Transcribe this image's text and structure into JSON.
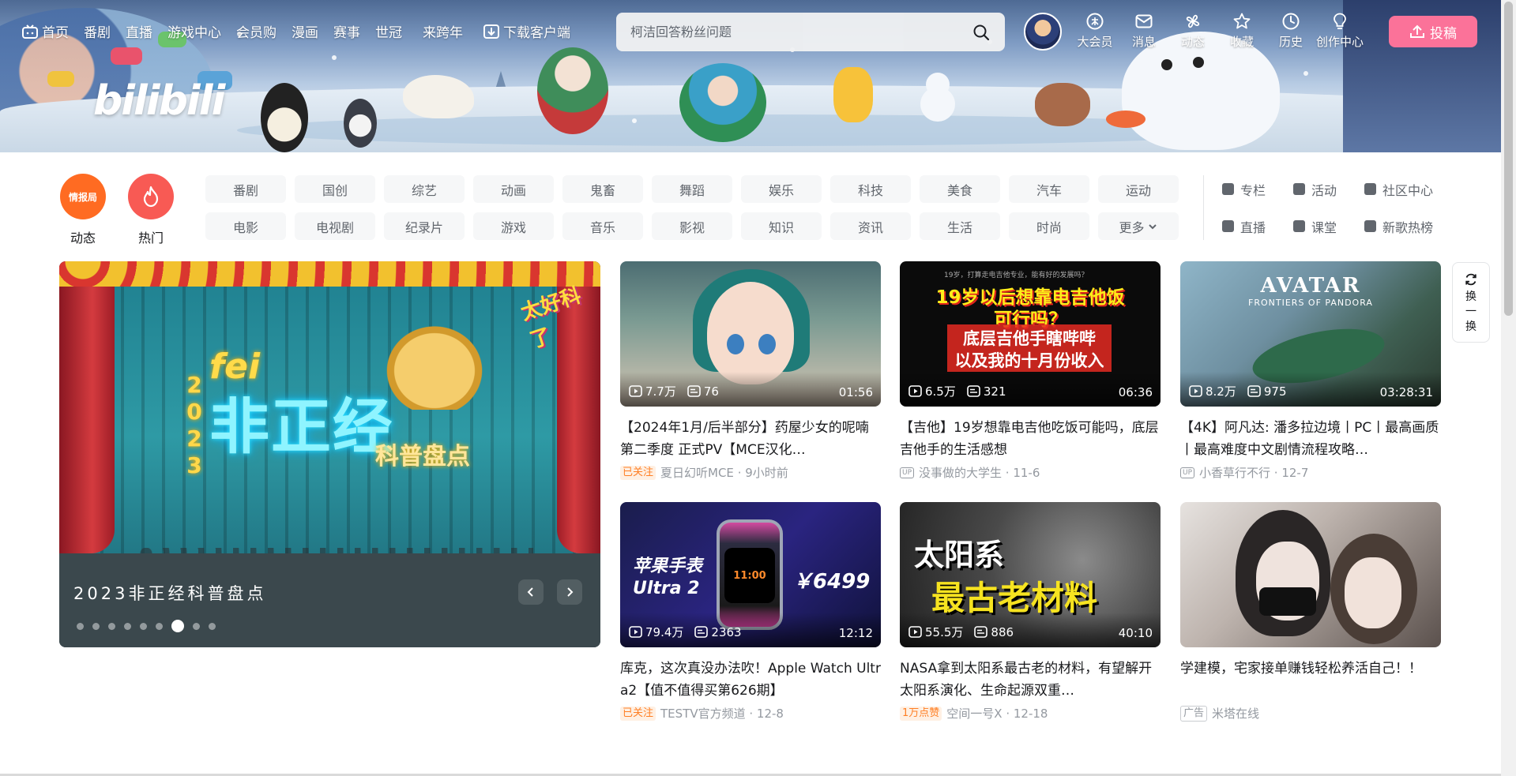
{
  "nav": {
    "items": [
      "首页",
      "番剧",
      "直播",
      "游戏中心",
      "会员购",
      "漫画",
      "赛事",
      "世冠",
      "来跨年",
      "下载客户端"
    ],
    "search_placeholder": "柯洁回答粉丝问题",
    "right_items": [
      "大会员",
      "消息",
      "动态",
      "收藏",
      "历史",
      "创作中心"
    ],
    "upload_label": "投稿"
  },
  "banner": {
    "logo_text": "bilibili"
  },
  "channels": {
    "big": [
      {
        "label": "动态",
        "badge": "情报局",
        "color": "#ff6b22"
      },
      {
        "label": "热门",
        "color": "#f85a54"
      }
    ],
    "grid": [
      "番剧",
      "国创",
      "综艺",
      "动画",
      "鬼畜",
      "舞蹈",
      "娱乐",
      "科技",
      "美食",
      "汽车",
      "运动",
      "电影",
      "电视剧",
      "纪录片",
      "游戏",
      "音乐",
      "影视",
      "知识",
      "资讯",
      "生活",
      "时尚",
      "更多"
    ],
    "right": [
      "专栏",
      "活动",
      "社区中心",
      "直播",
      "课堂",
      "新歌热榜"
    ]
  },
  "carousel": {
    "title": "2023非正经科普盘点",
    "art": {
      "fei": "fei",
      "year_digits": [
        "2",
        "0",
        "2",
        "3"
      ],
      "main": "非正经",
      "sub": "科普盘点",
      "badge": "太好科了"
    },
    "dot_count": 9,
    "active_dot": 6
  },
  "videos": [
    {
      "views": "7.7万",
      "danmaku": "76",
      "duration": "01:56",
      "title": "【2024年1月/后半部分】药屋少女的呢喃 第二季度 正式PV【MCE汉化…",
      "tag": "已关注",
      "tag_type": "followed",
      "author": "夏日幻听MCE",
      "time": "9小时前"
    },
    {
      "views": "6.5万",
      "danmaku": "321",
      "duration": "06:36",
      "title": "【吉他】19岁想靠电吉他吃饭可能吗，底层吉他手的生活感想",
      "tag": "",
      "tag_type": "up",
      "author": "没事做的大学生",
      "time": "11-6",
      "thumb_text": {
        "top_small": "19岁，打算走电吉他专业，能有好的发展吗？",
        "line1": "19岁以后想靠电吉他饭",
        "line2": "可行吗？",
        "line3": "底层吉他手瞎哔哔",
        "line4": "以及我的十月份收入"
      }
    },
    {
      "views": "8.2万",
      "danmaku": "975",
      "duration": "03:28:31",
      "title": "【4K】阿凡达: 潘多拉边境丨PC丨最高画质丨最高难度中文剧情流程攻略…",
      "tag": "",
      "tag_type": "up",
      "author": "小香草行不行",
      "time": "12-7",
      "thumb_text": {
        "title": "AVATAR",
        "sub": "FRONTIERS OF PANDORA"
      }
    },
    {
      "views": "79.4万",
      "danmaku": "2363",
      "duration": "12:12",
      "title": "库克，这次真没办法吹！Apple Watch Ultra2【值不值得买第626期】",
      "tag": "已关注",
      "tag_type": "followed",
      "author": "TESTV官方频道",
      "time": "12-8",
      "thumb_text": {
        "l1": "苹果手表",
        "l2": "Ultra 2",
        "price": "￥6499",
        "screen": "11:00"
      }
    },
    {
      "views": "55.5万",
      "danmaku": "886",
      "duration": "40:10",
      "title": "NASA拿到太阳系最古老的材料，有望解开太阳系演化、生命起源双重…",
      "tag": "1万点赞",
      "tag_type": "likes",
      "author": "空间一号X",
      "time": "12-18",
      "thumb_text": {
        "l1": "太阳系",
        "l2": "最古老材料"
      }
    },
    {
      "views": "",
      "danmaku": "",
      "duration": "",
      "title": "学建模，宅家接单赚钱轻松养活自己！！",
      "tag": "广告",
      "tag_type": "ad",
      "author": "米塔在线",
      "time": ""
    }
  ],
  "refresh_label": [
    "换",
    "一",
    "换"
  ],
  "colors": {
    "pink": "#fb7299",
    "orange": "#ff7f24",
    "text": "#18191c",
    "grey": "#9499a0"
  }
}
